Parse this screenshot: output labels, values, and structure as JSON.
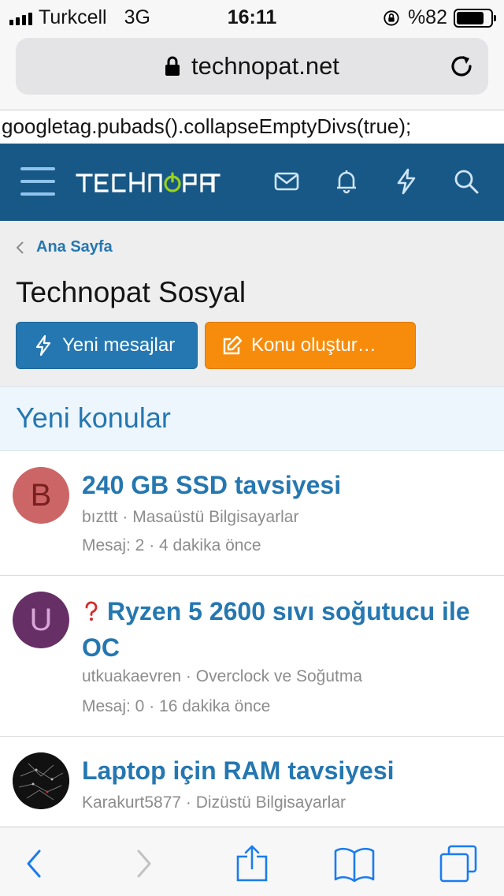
{
  "status_bar": {
    "carrier": "Turkcell",
    "network": "3G",
    "time": "16:11",
    "battery": "%82",
    "battery_level": 0.82
  },
  "browser": {
    "url": "technopat.net"
  },
  "script_text": "googletag.pubads().collapseEmptyDivs(true);",
  "site": {
    "logo_text": "TECHNOPAT",
    "brand_color": "#185886",
    "nav_icons": [
      "mail-icon",
      "bell-icon",
      "lightning-icon",
      "search-icon"
    ]
  },
  "breadcrumb": {
    "label": "Ana Sayfa"
  },
  "page": {
    "title": "Technopat Sosyal",
    "new_messages_label": "Yeni mesajlar",
    "create_topic_label": "Konu oluştur…",
    "section_title": "Yeni konular"
  },
  "topics": [
    {
      "title": "240 GB SSD tavsiyesi",
      "author": "bızttt",
      "forum": "Masaüstü Bilgisayarlar",
      "stats": "Mesaj: 2 · 4 dakika önce",
      "avatar_letter": "B",
      "avatar_color": "#cc6666"
    },
    {
      "title": "Ryzen 5 2600 sıvı soğutucu ile OC",
      "author": "utkuakaevren",
      "forum": "Overclock ve Soğutma",
      "stats": "Mesaj: 0 · 16 dakika önce",
      "avatar_letter": "U",
      "avatar_color": "#662f66",
      "has_question_icon": true
    },
    {
      "title": "Laptop için RAM tavsiyesi",
      "author": "Karakurt5877",
      "forum": "Dizüstü Bilgisayarlar",
      "avatar_letter": "",
      "avatar_color": "#111111"
    }
  ],
  "toolbar_icons": [
    "back-icon",
    "forward-icon",
    "share-icon",
    "bookmarks-icon",
    "tabs-icon"
  ]
}
